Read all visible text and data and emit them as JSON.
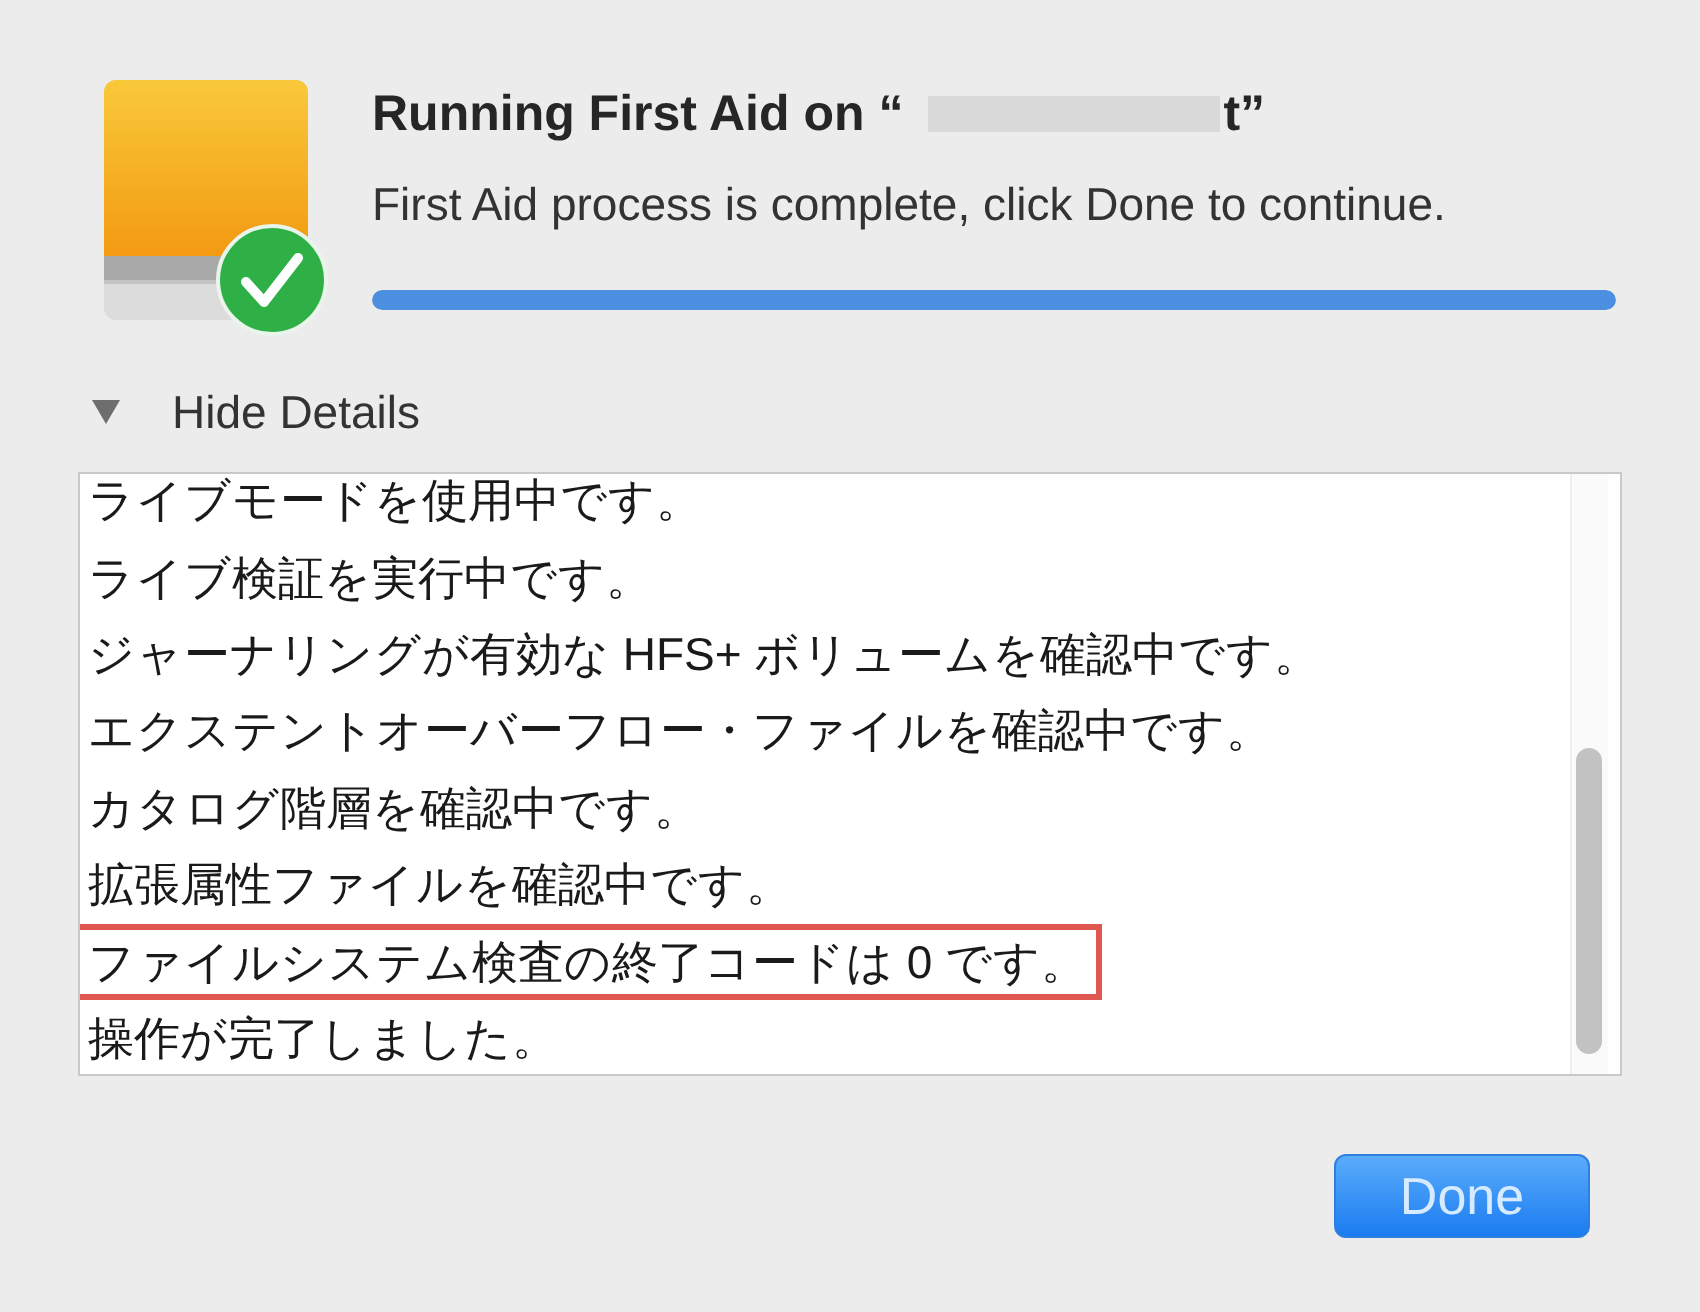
{
  "header": {
    "title": {
      "prefix": "Running First Aid on “",
      "redacted": true,
      "suffix": "t”"
    },
    "message": "First Aid process is complete, click Done to continue.",
    "progress": {
      "level": 1
    }
  },
  "details_toggle": {
    "label": "Hide Details",
    "expanded": true
  },
  "log": {
    "lines": [
      {
        "text": "ライブモードを使用中です。",
        "highlighted": false
      },
      {
        "text": "ライブ検証を実行中です。",
        "highlighted": false
      },
      {
        "text": "ジャーナリングが有効な HFS+ ボリュームを確認中です。",
        "highlighted": false
      },
      {
        "text": "エクステントオーバーフロー・ファイルを確認中です。",
        "highlighted": false
      },
      {
        "text": "カタログ階層を確認中です。",
        "highlighted": false
      },
      {
        "text": "拡張属性ファイルを確認中です。",
        "highlighted": false
      },
      {
        "text": "ファイルシステム検査の終了コードは 0 です。",
        "highlighted": true
      },
      {
        "text": "操作が完了しました。",
        "highlighted": false
      }
    ]
  },
  "primary_button": {
    "label": "Done"
  }
}
